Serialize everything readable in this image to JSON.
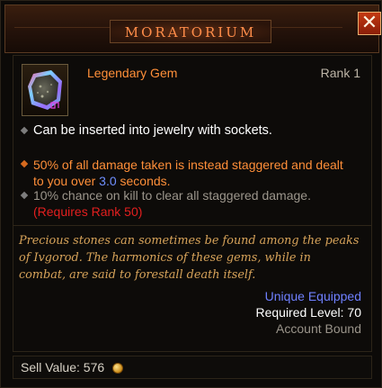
{
  "window": {
    "title": "MORATORIUM",
    "close_glyph": "✕"
  },
  "item": {
    "icon": "legendary-gem-icon",
    "type": "Legendary Gem",
    "rank": "Rank 1"
  },
  "primary": {
    "socket_text": "Can be inserted into jewelry with sockets."
  },
  "secondary": {
    "effect_part1": "50% of all damage taken is instead staggered and dealt to you over ",
    "effect_value": "3.0",
    "effect_part2": " seconds.",
    "rank_effect": "10% chance on kill to clear all staggered damage.",
    "rank_requirement": "(Requires Rank 50)"
  },
  "flavor": "Precious stones can sometimes be found among the peaks of Ivgorod. The harmonics of these gems, while in combat, are said to forestall death itself.",
  "footer": {
    "unique": "Unique Equipped",
    "required_level": "Required Level: 70",
    "bound": "Account Bound"
  },
  "sell": {
    "label": "Sell Value:",
    "value": "576",
    "icon": "gold-coin-icon"
  },
  "colors": {
    "legendary_orange": "#ff8f39",
    "title_orange": "#ff8d4a",
    "value_blue": "#6f8fff",
    "unique_blue": "#6f80ff",
    "requirement_red": "#e31f1f",
    "flavor_gold": "#d7a35a"
  }
}
